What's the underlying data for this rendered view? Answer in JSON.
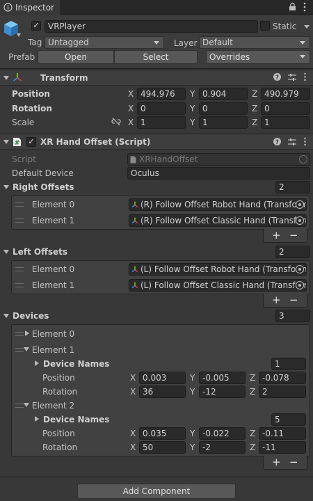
{
  "tab": {
    "title": "Inspector"
  },
  "header": {
    "object_name": "VRPlayer",
    "static_label": "Static",
    "tag_label": "Tag",
    "tag_value": "Untagged",
    "layer_label": "Layer",
    "layer_value": "Default",
    "prefab_label": "Prefab",
    "open_label": "Open",
    "select_label": "Select",
    "overrides_label": "Overrides"
  },
  "transform": {
    "title": "Transform",
    "position_label": "Position",
    "rotation_label": "Rotation",
    "scale_label": "Scale",
    "position": {
      "x": "494.976",
      "y": "0.904",
      "z": "490.979"
    },
    "rotation": {
      "x": "0",
      "y": "0",
      "z": "0"
    },
    "scale": {
      "x": "1",
      "y": "1",
      "z": "1"
    }
  },
  "axes": {
    "x": "X",
    "y": "Y",
    "z": "Z"
  },
  "script": {
    "title": "XR Hand Offset (Script)",
    "script_label": "Script",
    "script_value": "XRHandOffset",
    "default_device_label": "Default Device",
    "default_device_value": "Oculus",
    "element_0": "Element 0",
    "element_1": "Element 1",
    "element_2": "Element 2",
    "right_offsets": {
      "label": "Right Offsets",
      "count": "2",
      "items": [
        "(R) Follow Offset Robot Hand (Transform)",
        "(R) Follow Offset Classic Hand (Transform)"
      ]
    },
    "left_offsets": {
      "label": "Left Offsets",
      "count": "2",
      "items": [
        "(L) Follow Offset Robot Hand (Transform)",
        "(L) Follow Offset Classic Hand (Transform)"
      ]
    },
    "devices": {
      "label": "Devices",
      "count": "3",
      "device_names_label": "Device Names",
      "position_label": "Position",
      "rotation_label": "Rotation",
      "element_1": {
        "device_names_count": "1",
        "position": {
          "x": "0.003",
          "y": "-0.005",
          "z": "-0.078"
        },
        "rotation": {
          "x": "36",
          "y": "-12",
          "z": "2"
        }
      },
      "element_2": {
        "device_names_count": "5",
        "position": {
          "x": "0.035",
          "y": "-0.022",
          "z": "-0.11"
        },
        "rotation": {
          "x": "50",
          "y": "-2",
          "z": "-11"
        }
      }
    }
  },
  "footer": {
    "add_component": "Add Component"
  },
  "symbols": {
    "plus": "+",
    "minus": "−",
    "check": "✓"
  },
  "colors": {
    "accent_blue": "#4a90d9",
    "panel": "#383838",
    "field": "#2a2a2a"
  }
}
